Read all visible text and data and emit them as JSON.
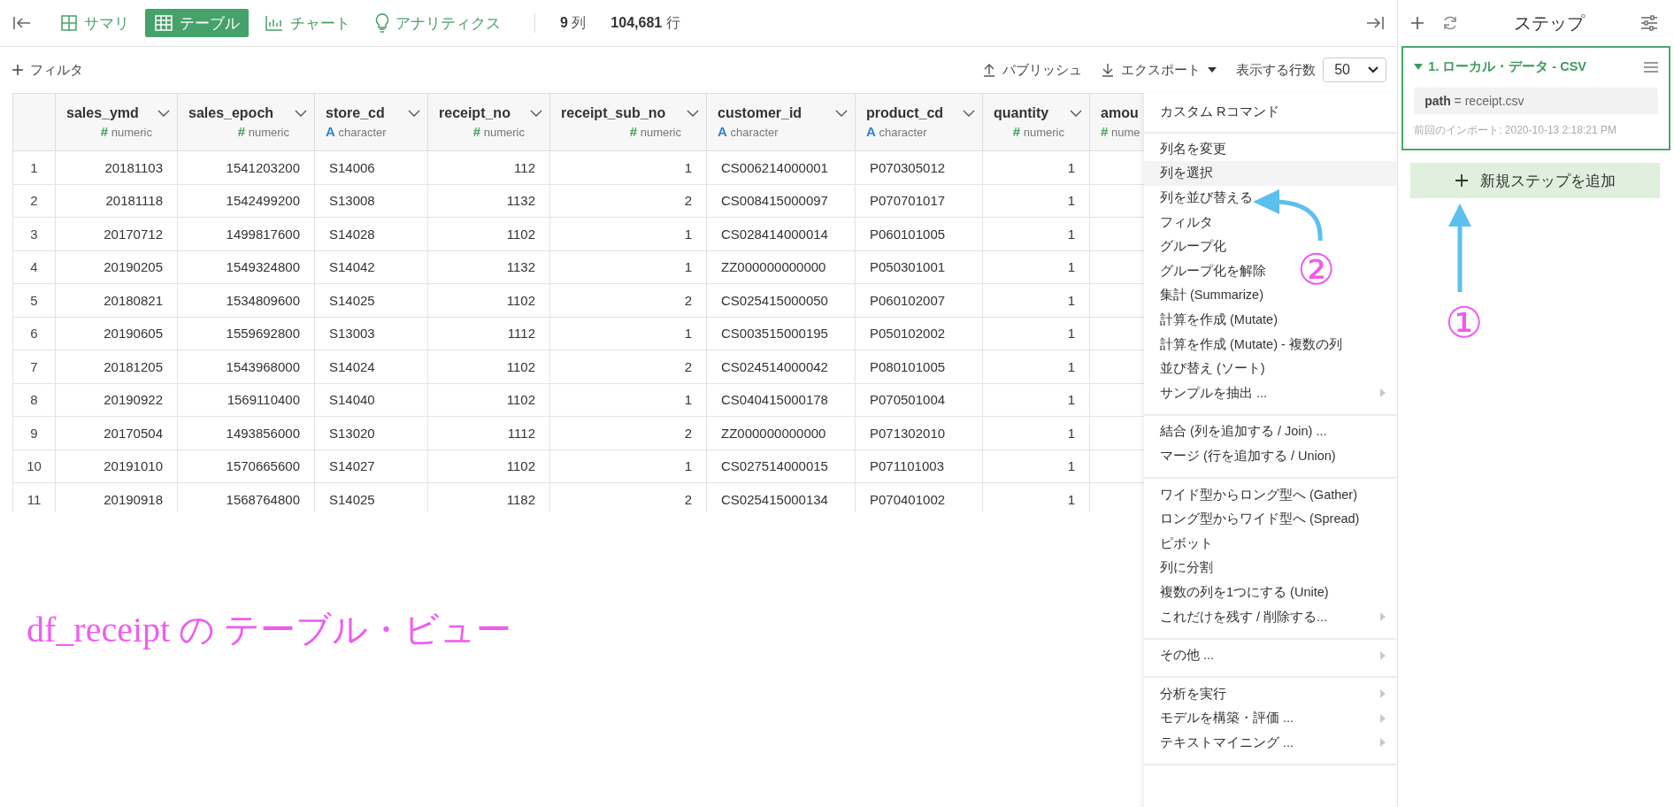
{
  "topbar": {
    "tabs": [
      {
        "label": "サマリ",
        "selected": false
      },
      {
        "label": "テーブル",
        "selected": true
      },
      {
        "label": "チャート",
        "selected": false
      },
      {
        "label": "アナリティクス",
        "selected": false
      }
    ],
    "column_count": "9",
    "column_unit": "列",
    "row_count": "104,681",
    "row_unit": "行"
  },
  "toolbar": {
    "filter": "フィルタ",
    "publish": "パブリッシュ",
    "export": "エクスポート",
    "rows_label": "表示する行数",
    "rows_value": "50"
  },
  "table": {
    "columns": [
      {
        "name": "sales_ymd",
        "type": "numeric",
        "type_icon": "#"
      },
      {
        "name": "sales_epoch",
        "type": "numeric",
        "type_icon": "#"
      },
      {
        "name": "store_cd",
        "type": "character",
        "type_icon": "A"
      },
      {
        "name": "receipt_no",
        "type": "numeric",
        "type_icon": "#"
      },
      {
        "name": "receipt_sub_no",
        "type": "numeric",
        "type_icon": "#"
      },
      {
        "name": "customer_id",
        "type": "character",
        "type_icon": "A"
      },
      {
        "name": "product_cd",
        "type": "character",
        "type_icon": "A"
      },
      {
        "name": "quantity",
        "type": "numeric",
        "type_icon": "#"
      },
      {
        "name": "amou",
        "type": "nume",
        "type_icon": "#"
      }
    ],
    "rows": [
      {
        "number": "1",
        "cells": [
          "20181103",
          "1541203200",
          "S14006",
          "112",
          "1",
          "CS006214000001",
          "P070305012",
          "1"
        ]
      },
      {
        "number": "2",
        "cells": [
          "20181118",
          "1542499200",
          "S13008",
          "1132",
          "2",
          "CS008415000097",
          "P070701017",
          "1"
        ]
      },
      {
        "number": "3",
        "cells": [
          "20170712",
          "1499817600",
          "S14028",
          "1102",
          "1",
          "CS028414000014",
          "P060101005",
          "1"
        ]
      },
      {
        "number": "4",
        "cells": [
          "20190205",
          "1549324800",
          "S14042",
          "1132",
          "1",
          "ZZ000000000000",
          "P050301001",
          "1"
        ]
      },
      {
        "number": "5",
        "cells": [
          "20180821",
          "1534809600",
          "S14025",
          "1102",
          "2",
          "CS025415000050",
          "P060102007",
          "1"
        ]
      },
      {
        "number": "6",
        "cells": [
          "20190605",
          "1559692800",
          "S13003",
          "1112",
          "1",
          "CS003515000195",
          "P050102002",
          "1"
        ]
      },
      {
        "number": "7",
        "cells": [
          "20181205",
          "1543968000",
          "S14024",
          "1102",
          "2",
          "CS024514000042",
          "P080101005",
          "1"
        ]
      },
      {
        "number": "8",
        "cells": [
          "20190922",
          "1569110400",
          "S14040",
          "1102",
          "1",
          "CS040415000178",
          "P070501004",
          "1"
        ]
      },
      {
        "number": "9",
        "cells": [
          "20170504",
          "1493856000",
          "S13020",
          "1112",
          "2",
          "ZZ000000000000",
          "P071302010",
          "1"
        ]
      },
      {
        "number": "10",
        "cells": [
          "20191010",
          "1570665600",
          "S14027",
          "1102",
          "1",
          "CS027514000015",
          "P071101003",
          "1"
        ]
      },
      {
        "number": "11",
        "cells": [
          "20190918",
          "1568764800",
          "S14025",
          "1182",
          "2",
          "CS025415000134",
          "P070401002",
          "1"
        ]
      }
    ]
  },
  "menu": {
    "sections": [
      {
        "items": [
          {
            "label": "カスタム Rコマンド",
            "selected": false,
            "submenu": false
          }
        ]
      },
      {
        "items": [
          {
            "label": "列名を変更",
            "selected": false,
            "submenu": false
          },
          {
            "label": "列を選択",
            "selected": true,
            "submenu": false
          },
          {
            "label": "列を並び替える",
            "selected": false,
            "submenu": false
          },
          {
            "label": "フィルタ",
            "selected": false,
            "submenu": false
          },
          {
            "label": "グループ化",
            "selected": false,
            "submenu": false
          },
          {
            "label": "グループ化を解除",
            "selected": false,
            "submenu": false
          },
          {
            "label": "集計 (Summarize)",
            "selected": false,
            "submenu": false
          },
          {
            "label": "計算を作成 (Mutate)",
            "selected": false,
            "submenu": false
          },
          {
            "label": "計算を作成 (Mutate) - 複数の列",
            "selected": false,
            "submenu": false
          },
          {
            "label": "並び替え (ソート)",
            "selected": false,
            "submenu": false
          },
          {
            "label": "サンプルを抽出 ...",
            "selected": false,
            "submenu": true
          }
        ]
      },
      {
        "items": [
          {
            "label": "結合 (列を追加する / Join) ...",
            "selected": false,
            "submenu": false
          },
          {
            "label": "マージ (行を追加する / Union)",
            "selected": false,
            "submenu": false
          }
        ]
      },
      {
        "items": [
          {
            "label": "ワイド型からロング型へ (Gather)",
            "selected": false,
            "submenu": false
          },
          {
            "label": "ロング型からワイド型へ (Spread)",
            "selected": false,
            "submenu": false
          },
          {
            "label": "ピボット",
            "selected": false,
            "submenu": false
          },
          {
            "label": "列に分割",
            "selected": false,
            "submenu": false
          },
          {
            "label": "複数の列を1つにする (Unite)",
            "selected": false,
            "submenu": false
          },
          {
            "label": "これだけを残す / 削除する...",
            "selected": false,
            "submenu": true
          }
        ]
      },
      {
        "items": [
          {
            "label": "その他 ...",
            "selected": false,
            "submenu": true
          }
        ]
      },
      {
        "items": [
          {
            "label": "分析を実行",
            "selected": false,
            "submenu": true
          },
          {
            "label": "モデルを構築・評価 ...",
            "selected": false,
            "submenu": true
          },
          {
            "label": "テキストマイニング ...",
            "selected": false,
            "submenu": true
          }
        ]
      }
    ]
  },
  "steps_panel": {
    "title": "ステップ",
    "steps": [
      {
        "title": "1. ローカル・データ - CSV",
        "expanded": true,
        "param_name": "path",
        "param_value": "= receipt.csv",
        "note": "前回のインポート: 2020-10-13 2:18:21 PM"
      }
    ],
    "add_button": "新規ステップを追加"
  },
  "annotations": {
    "caption": "df_receipt の テーブル・ビュー",
    "markers": [
      "①",
      "②"
    ]
  }
}
